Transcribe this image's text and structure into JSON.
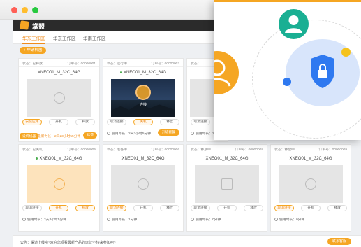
{
  "app": {
    "brand": "掌盟"
  },
  "tabs": [
    {
      "label": "华东工作区",
      "active": true
    },
    {
      "label": "华东工作区",
      "active": false
    },
    {
      "label": "华南工作区",
      "active": false
    }
  ],
  "add_button": "+ 申请机器",
  "cards": [
    {
      "status": "状态：已释放",
      "number": "订单号：00000001",
      "name": "XNEO01_M_32C_64G",
      "buttons": [
        "安装应用",
        "开机",
        "释放"
      ],
      "footer_badge": "设机机器",
      "footer_text": "最新时长：2天23小时55分钟",
      "footer_button": "续费"
    },
    {
      "status": "状态：运行中",
      "number": "订单号：00000003",
      "name": "XNEO01_M_32C_64G",
      "screen_label": "连接",
      "buttons": [
        "取消连接",
        "关机",
        "释放"
      ],
      "footer_text": "使用时长：2天3小时5分钟",
      "footer_button": "升级套餐"
    },
    {
      "status": "状态：",
      "number": "",
      "name": "",
      "buttons": [
        "取消连接"
      ],
      "footer_text": "使用时长：2"
    },
    {
      "status": "状态：已关机",
      "number": "订单号：00000005",
      "name": "XNEO01_M_32C_64G",
      "buttons": [
        "取消连接",
        "开机",
        "释放"
      ],
      "footer_text": "使用时长：2天3小时5分钟"
    },
    {
      "status": "状态：准备中",
      "number": "订单号：00000006",
      "name": "XNEO01_M_32C_64G",
      "buttons": [
        "取消连接",
        "开机",
        "释放"
      ],
      "footer_text": "使用时长：1分钟"
    },
    {
      "status": "状态：释放中",
      "number": "订单号：00000008",
      "name": "XNEO01_M_32C_64G",
      "buttons": [
        "取消连接",
        "开机",
        "释放"
      ],
      "footer_text": "使用时长：0分钟"
    },
    {
      "status": "状态：释放中",
      "number": "订单号：00000009",
      "name": "XNEO01_M_32C_64G",
      "buttons": [
        "取消连接",
        "开机",
        "释放"
      ],
      "footer_text": "使用时长：0分钟"
    }
  ],
  "notice": {
    "text": "公告：渠道上线啦~欢迎您观看最新产品的运营~~快来参加吧~",
    "button": "联系客服"
  },
  "colors": {
    "accent": "#f5a623",
    "dark": "#2b2b2b",
    "teal": "#1aaf93",
    "blue": "#2f79f0"
  }
}
